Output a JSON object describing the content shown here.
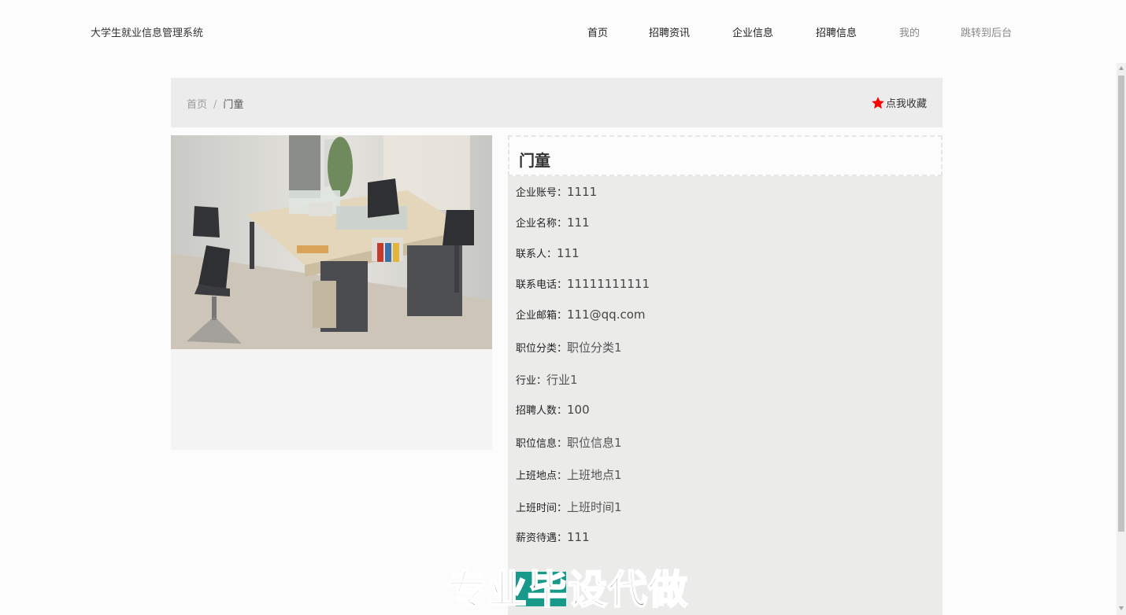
{
  "brand": "大学生就业信息管理系统",
  "nav": [
    "首页",
    "招聘资讯",
    "企业信息",
    "招聘信息",
    "我的",
    "跳转到后台"
  ],
  "breadcrumb": {
    "home": "首页",
    "sep": "/",
    "current": "门童"
  },
  "favorite": {
    "label": "点我收藏",
    "star_color": "#ff0000"
  },
  "detail": {
    "title": "门童",
    "fields": [
      {
        "label": "企业账号：",
        "value": "1111"
      },
      {
        "label": "企业名称：",
        "value": "111"
      },
      {
        "label": "联系人：",
        "value": "111"
      },
      {
        "label": "联系电话：",
        "value": "11111111111"
      },
      {
        "label": "企业邮箱：",
        "value": "111@qq.com"
      },
      {
        "label": "职位分类：",
        "value": "职位分类1"
      },
      {
        "label": "行业：",
        "value": "行业1"
      },
      {
        "label": "招聘人数：",
        "value": "100"
      },
      {
        "label": "职位信息：",
        "value": "职位信息1"
      },
      {
        "label": "上班地点：",
        "value": "上班地点1"
      },
      {
        "label": "上班时间：",
        "value": "上班时间1"
      },
      {
        "label": "薪资待遇：",
        "value": "111"
      }
    ],
    "apply_button_color": "#179a8a"
  },
  "watermark": "专业毕设代做"
}
